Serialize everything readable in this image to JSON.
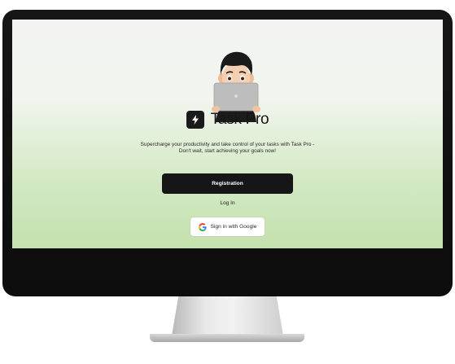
{
  "app": {
    "name": "Task Pro",
    "tagline": "Supercharge your productivity and take control of your tasks with Task Pro - Don't wait, start achieving your goals now!"
  },
  "actions": {
    "register_label": "Registration",
    "login_label": "Log In",
    "google_label": "Sign in with Google"
  },
  "icons": {
    "brand_logo": "lightning-bolt-icon",
    "google": "google-g-icon",
    "avatar": "avatar-illustration"
  },
  "colors": {
    "button_dark": "#161616",
    "screen_gradient_top": "#f3f3f3",
    "screen_gradient_bottom": "#c3e1ad"
  }
}
